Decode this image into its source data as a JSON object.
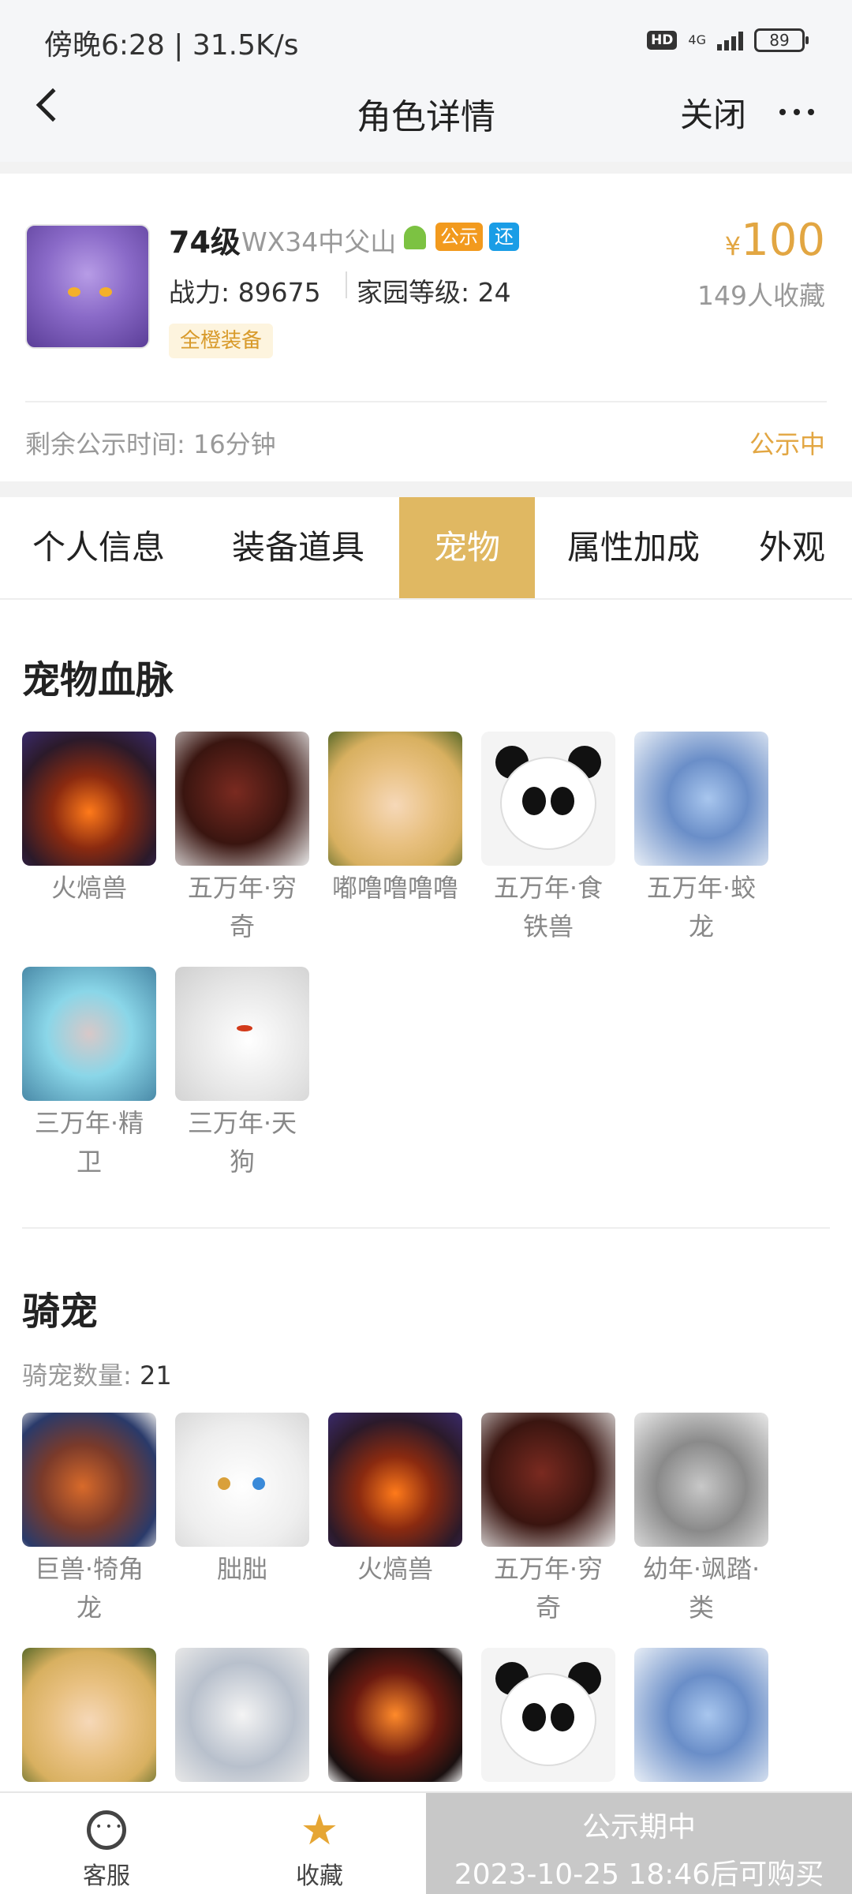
{
  "status_bar": {
    "time_speed": "傍晚6:28 | 31.5K/s",
    "hd": "HD",
    "network": "4G",
    "battery": "89"
  },
  "header": {
    "title": "角色详情",
    "close_label": "关闭"
  },
  "role": {
    "level": "74级",
    "server": "WX34中父山",
    "tag_public": "公示",
    "tag_return": "还",
    "power": "战力: 89675",
    "home_level": "家园等级: 24",
    "badge": "全橙装备",
    "price_symbol": "¥",
    "price": "100",
    "favorites": "149人收藏",
    "remaining_time": "剩余公示时间: 16分钟",
    "status": "公示中"
  },
  "tabs": [
    "个人信息",
    "装备道具",
    "宠物",
    "属性加成",
    "外观"
  ],
  "active_tab": "宠物",
  "pet_blood": {
    "title": "宠物血脉",
    "items": [
      {
        "name": "火熇兽",
        "icon": "fire-beast"
      },
      {
        "name": "五万年·穷奇",
        "icon": "qiongqi"
      },
      {
        "name": "嘟噜噜噜噜",
        "icon": "girl"
      },
      {
        "name": "五万年·食铁兽",
        "icon": "panda"
      },
      {
        "name": "五万年·蛟龙",
        "icon": "dragon"
      },
      {
        "name": "三万年·精卫",
        "icon": "jingwei"
      },
      {
        "name": "三万年·天狗",
        "icon": "wolf"
      }
    ]
  },
  "mounts": {
    "title": "骑宠",
    "count_label": "骑宠数量:",
    "count": "21",
    "items": [
      {
        "name": "巨兽·犄角龙",
        "icon": "horn-dragon"
      },
      {
        "name": "朏朏",
        "icon": "cat"
      },
      {
        "name": "火熇兽",
        "icon": "fire-beast"
      },
      {
        "name": "五万年·穷奇",
        "icon": "qiongqi"
      },
      {
        "name": "幼年·飒踏·类",
        "icon": "kitten"
      },
      {
        "name": "",
        "icon": "girl"
      },
      {
        "name": "",
        "icon": "white-beast"
      },
      {
        "name": "",
        "icon": "lava-beast"
      },
      {
        "name": "",
        "icon": "panda"
      },
      {
        "name": "",
        "icon": "dragon"
      }
    ]
  },
  "bottom_bar": {
    "service_label": "客服",
    "favorite_label": "收藏",
    "buy_line1": "公示期中",
    "buy_line2": "2023-10-25 18:46后可购买"
  },
  "colors": {
    "accent": "#e2a642",
    "tab_active_bg": "#e0b862",
    "buy_disabled_bg": "#c8c8c8"
  }
}
